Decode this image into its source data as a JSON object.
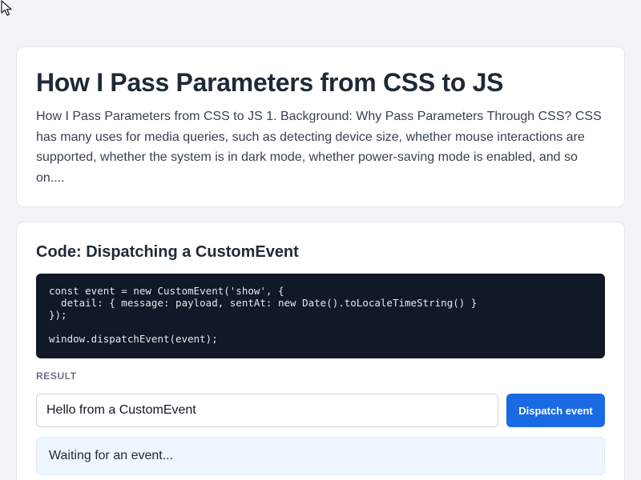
{
  "intro": {
    "title": "How I Pass Parameters from CSS to JS",
    "text": "How I Pass Parameters from CSS to JS 1. Background: Why Pass Parameters Through CSS? CSS has many uses for media queries, such as detecting device size, whether mouse interactions are supported, whether the system is in dark mode, whether power-saving mode is enabled, and so on...."
  },
  "code_section": {
    "title": "Code: Dispatching a CustomEvent",
    "code": "const event = new CustomEvent('show', {\n  detail: { message: payload, sentAt: new Date().toLocaleTimeString() }\n});\n\nwindow.dispatchEvent(event);",
    "result_label": "RESULT",
    "input_value": "Hello from a CustomEvent",
    "button_label": "Dispatch event",
    "status_text": "Waiting for an event..."
  },
  "colors": {
    "accent": "#1a6ae3",
    "code_background": "#111827",
    "status_background": "#eff6ff"
  },
  "icons": {
    "cursor": "mouse-pointer-icon"
  }
}
